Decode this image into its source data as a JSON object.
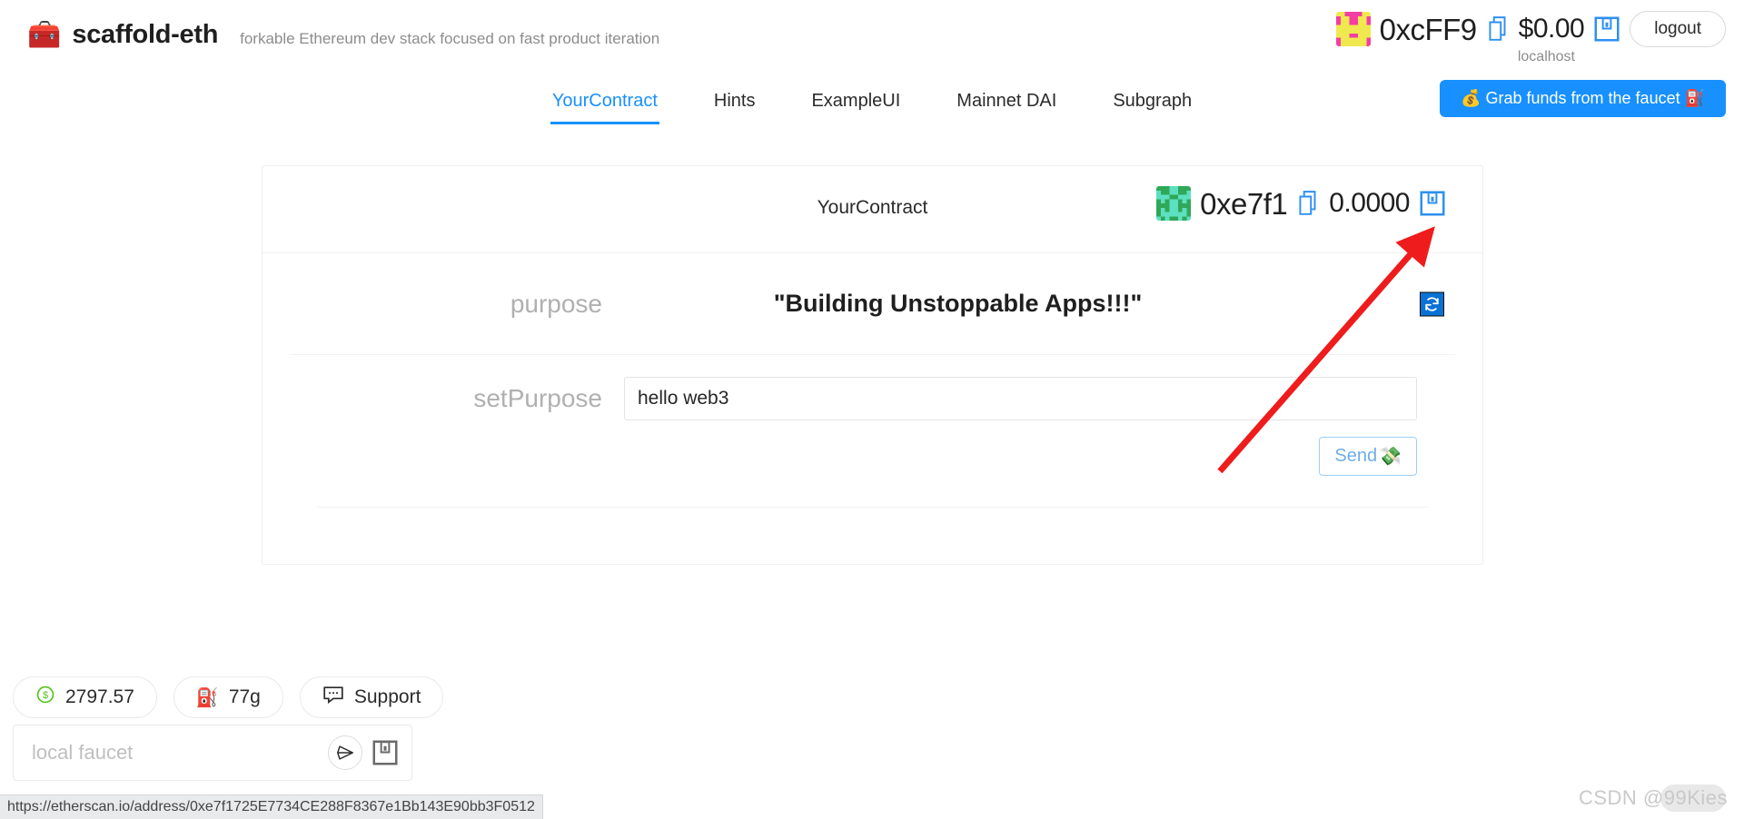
{
  "header": {
    "logo_icon": "toolbox-icon",
    "brand": "scaffold-eth",
    "tagline": "forkable Ethereum dev stack focused on fast product iteration",
    "account": {
      "address": "0xcFF9",
      "copy_icon": "copy-icon",
      "balance": "$0.00",
      "save_icon": "save-icon",
      "network": "localhost",
      "logout_label": "logout",
      "blockie_colors": [
        "#efe94f",
        "#f43ea3"
      ]
    },
    "faucet_button": "💰 Grab funds from the faucet ⛽"
  },
  "tabs": [
    {
      "label": "YourContract",
      "active": true
    },
    {
      "label": "Hints",
      "active": false
    },
    {
      "label": "ExampleUI",
      "active": false
    },
    {
      "label": "Mainnet DAI",
      "active": false
    },
    {
      "label": "Subgraph",
      "active": false
    }
  ],
  "card": {
    "title": "YourContract",
    "account": {
      "address": "0xe7f1",
      "copy_icon": "copy-icon",
      "balance": "0.0000",
      "save_icon": "save-icon",
      "blockie_colors": [
        "#5ce0c0",
        "#2fa85a"
      ]
    },
    "read_row": {
      "label": "purpose",
      "value": "\"Building Unstoppable Apps!!!\"",
      "refresh_icon": "refresh-icon"
    },
    "write_row": {
      "label": "setPurpose",
      "input_value": "hello web3",
      "input_placeholder": "",
      "send_label": "Send",
      "send_icon": "💸"
    }
  },
  "footer": {
    "pills": [
      {
        "icon": "dollar-coin-icon",
        "label": "2797.57"
      },
      {
        "icon": "gas-pump-icon",
        "label": "77g"
      },
      {
        "icon": "chat-bubble-icon",
        "label": "Support"
      }
    ],
    "faucet": {
      "placeholder": "local faucet",
      "send_icon": "send-arrow-icon",
      "save_icon": "save-icon"
    }
  },
  "statusbar": {
    "url": "https://etherscan.io/address/0xe7f1725E7734CE288F8367e1Bb143E90bb3F0512"
  },
  "watermark": "CSDN @99Kies",
  "colors": {
    "accent": "#1890ff",
    "annotation_arrow": "#ee1c1c",
    "muted": "#b0b0b0"
  }
}
